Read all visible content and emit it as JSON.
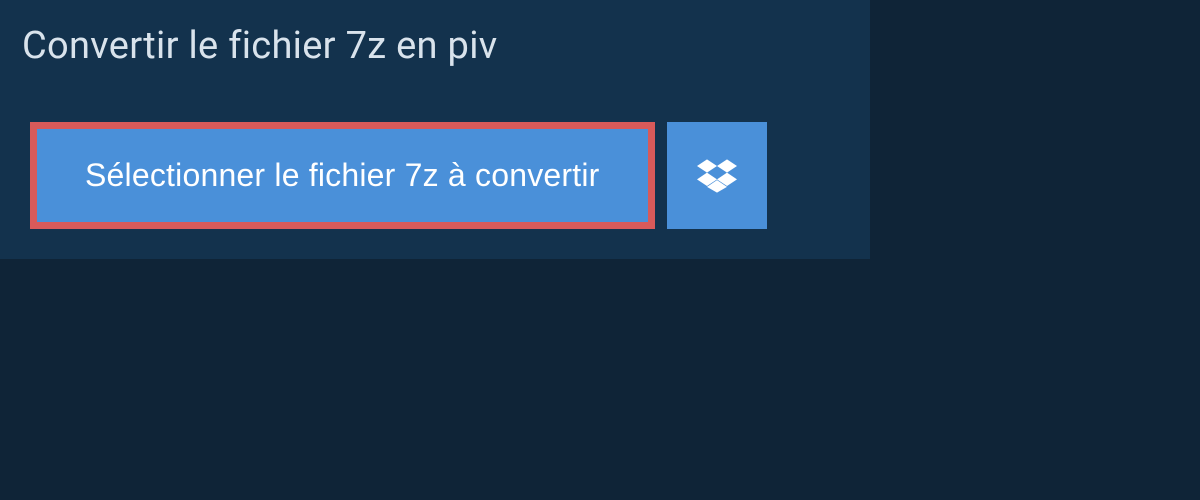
{
  "header": {
    "title": "Convertir le fichier 7z en piv"
  },
  "actions": {
    "select_file_label": "Sélectionner le fichier 7z à convertir"
  }
}
